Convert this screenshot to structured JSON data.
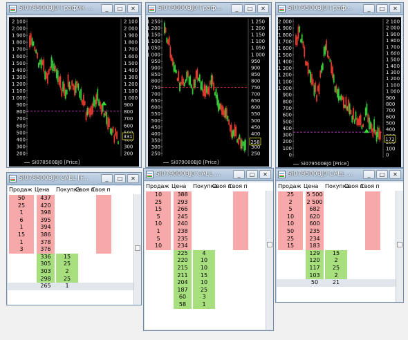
{
  "windows": [
    {
      "title": "Si078500BJ0 График ...",
      "legend": "Si078500BJ0 [Price]",
      "axis": [
        "2 100",
        "2 000",
        "1 900",
        "1 800",
        "1 700",
        "1 600",
        "1 500",
        "1 400",
        "1 300",
        "1 200",
        "1 100",
        "1 000",
        "900",
        "800",
        "700",
        "600",
        "500",
        "400",
        "300",
        "200"
      ],
      "right_axis": [
        "2 100",
        "2 000",
        "1 900",
        "1 800",
        "1 700",
        "1 600",
        "1 500",
        "1 400",
        "1 300",
        "1 200",
        "1 100",
        "1 000",
        "900",
        "800",
        "700",
        "600",
        "500",
        "400",
        "300",
        "200"
      ],
      "price_tag": "331"
    },
    {
      "title": "Si079000BJ0 Граф...",
      "legend": "Si079000BJ0 [Price]",
      "axis": [
        "1 250",
        "1 200",
        "1 150",
        "1 100",
        "1 050",
        "1 000",
        "950",
        "900",
        "850",
        "800",
        "750",
        "700",
        "650",
        "600",
        "550",
        "500",
        "450",
        "400",
        "350",
        "300",
        "250"
      ],
      "right_axis": [
        "1 250",
        "1 200",
        "1 150",
        "1 100",
        "1 050",
        "1 000",
        "950",
        "900",
        "850",
        "800",
        "750",
        "700",
        "650",
        "600",
        "550",
        "500",
        "450",
        "400",
        "350",
        "300",
        "250"
      ],
      "price_tag": "258"
    },
    {
      "title": "Si079500BJ0 Граф...",
      "legend": "Si079500BJ0 [Price]",
      "axis": [
        "2 000",
        "1 900",
        "1 800",
        "1 700",
        "1 600",
        "1 500",
        "1 400",
        "1 300",
        "1 200",
        "1 100",
        "1 000",
        "900",
        "800",
        "700",
        "600",
        "500",
        "400",
        "300",
        "200",
        "100",
        "0"
      ],
      "right_axis": [
        "2 100",
        "2 000",
        "1 900",
        "1 800",
        "1 700",
        "1 600",
        "1 500",
        "1 400",
        "1 300",
        "1 200",
        "1 100",
        "1 000",
        "900",
        "800",
        "700",
        "600",
        "500",
        "400",
        "300",
        "200",
        "100",
        "0"
      ],
      "price_tag": "172"
    }
  ],
  "tables": [
    {
      "title": "Si078500BJ0 CALL [F...",
      "headers": [
        "Продаж",
        "Цена",
        "Покупка",
        "Своя п",
        "Своя п"
      ],
      "sell": [
        [
          "50",
          "437"
        ],
        [
          "25",
          "420"
        ],
        [
          "1",
          "398"
        ],
        [
          "6",
          "395"
        ],
        [
          "1",
          "394"
        ],
        [
          "15",
          "386"
        ],
        [
          "1",
          "378"
        ],
        [
          "3",
          "376"
        ]
      ],
      "buy": [
        [
          "336",
          "15"
        ],
        [
          "305",
          "25"
        ],
        [
          "303",
          "2"
        ],
        [
          "298",
          "25"
        ]
      ],
      "last": [
        "265",
        "1"
      ]
    },
    {
      "title": "Si079000BJ0 CALL ...",
      "headers": [
        "Продаж",
        "Цена",
        "Покупка",
        "Своя п",
        "Своя п"
      ],
      "sell": [
        [
          "10",
          "388"
        ],
        [
          "25",
          "293"
        ],
        [
          "15",
          "266"
        ],
        [
          "5",
          "245"
        ],
        [
          "10",
          "240"
        ],
        [
          "1",
          "238"
        ],
        [
          "5",
          "235"
        ],
        [
          "10",
          "234"
        ]
      ],
      "buy": [
        [
          "225",
          "4"
        ],
        [
          "220",
          "10"
        ],
        [
          "215",
          "10"
        ],
        [
          "211",
          "15"
        ],
        [
          "204",
          "10"
        ],
        [
          "187",
          "25"
        ],
        [
          "60",
          "3"
        ],
        [
          "58",
          "1"
        ]
      ],
      "last": null
    },
    {
      "title": "Si079500BJ0 CALL ...",
      "headers": [
        "Продаж",
        "Цена",
        "Покупка",
        "Своя п",
        "Своя п"
      ],
      "sell": [
        [
          "25",
          "5 500"
        ],
        [
          "2",
          "2 500"
        ],
        [
          "5",
          "682"
        ],
        [
          "10",
          "620"
        ],
        [
          "10",
          "600"
        ],
        [
          "50",
          "235"
        ],
        [
          "25",
          "234"
        ],
        [
          "15",
          "183"
        ]
      ],
      "buy": [
        [
          "129",
          "15"
        ],
        [
          "120",
          "2"
        ],
        [
          "117",
          "25"
        ],
        [
          "103",
          "2"
        ]
      ],
      "last": [
        "50",
        "21"
      ]
    }
  ],
  "buttons": {
    "min": "_",
    "max": "□",
    "close": "✕"
  },
  "colors": {
    "sell": "#f7a8a8",
    "buy": "#a7df7e",
    "bull": "#39c73a",
    "bear": "#e23a2e",
    "support": "#d23cd2"
  }
}
